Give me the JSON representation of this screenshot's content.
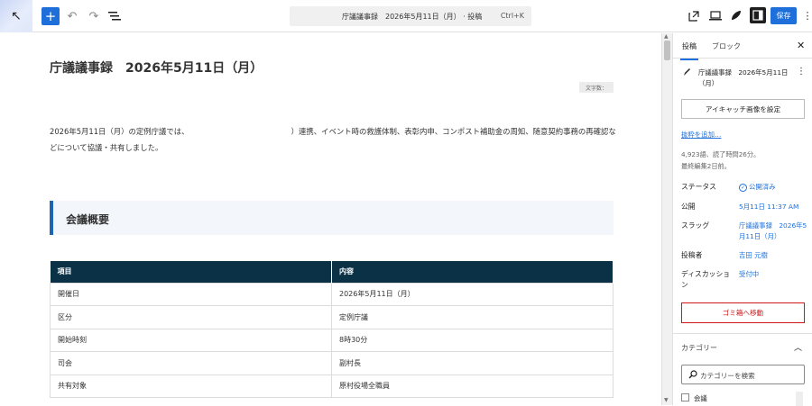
{
  "toolbar": {
    "command_text": "庁議議事録　2026年5月11日（月） · 投稿",
    "shortcut": "Ctrl+K",
    "save_label": "保存"
  },
  "editor": {
    "title": "庁議議事録　2026年5月11日（月）",
    "word_count_badge": "文字数：",
    "paragraph": "2026年5月11日（月）の定例庁議では、　　　　　　　　　　　　　　）連携、イベント時の救護体制、表彰内申、コンポスト補助金の周知、随意契約事務の再確認などについて協議・共有しました。",
    "heading": "会議概要",
    "table": {
      "headers": [
        "項目",
        "内容"
      ],
      "rows": [
        [
          "開催日",
          "2026年5月11日（月）"
        ],
        [
          "区分",
          "定例庁議"
        ],
        [
          "開始時刻",
          "8時30分"
        ],
        [
          "司会",
          "副村長"
        ],
        [
          "共有対象",
          "原村役場全職員"
        ]
      ]
    }
  },
  "sidebar": {
    "tab_post": "投稿",
    "tab_block": "ブロック",
    "post_title": "庁議議事録　2026年5月11日（月）",
    "featured_image": "アイキャッチ画像を設定",
    "add_excerpt": "抜粋を追加…",
    "stats_line1": "4,923語、読了時間26分。",
    "stats_line2": "最終編集2日前。",
    "status_label": "ステータス",
    "status_value": "公開済み",
    "publish_label": "公開",
    "publish_value": "5月11日 11:37 AM",
    "slug_label": "スラッグ",
    "slug_value": "庁議議事録　2026年5月11日（月）",
    "author_label": "投稿者",
    "author_value": "吉田 元樹",
    "discussion_label": "ディスカッション",
    "discussion_value": "受付中",
    "trash_label": "ゴミ箱へ移動",
    "category_label": "カテゴリー",
    "category_search_placeholder": "カテゴリーを検索",
    "category_item": "会議"
  }
}
